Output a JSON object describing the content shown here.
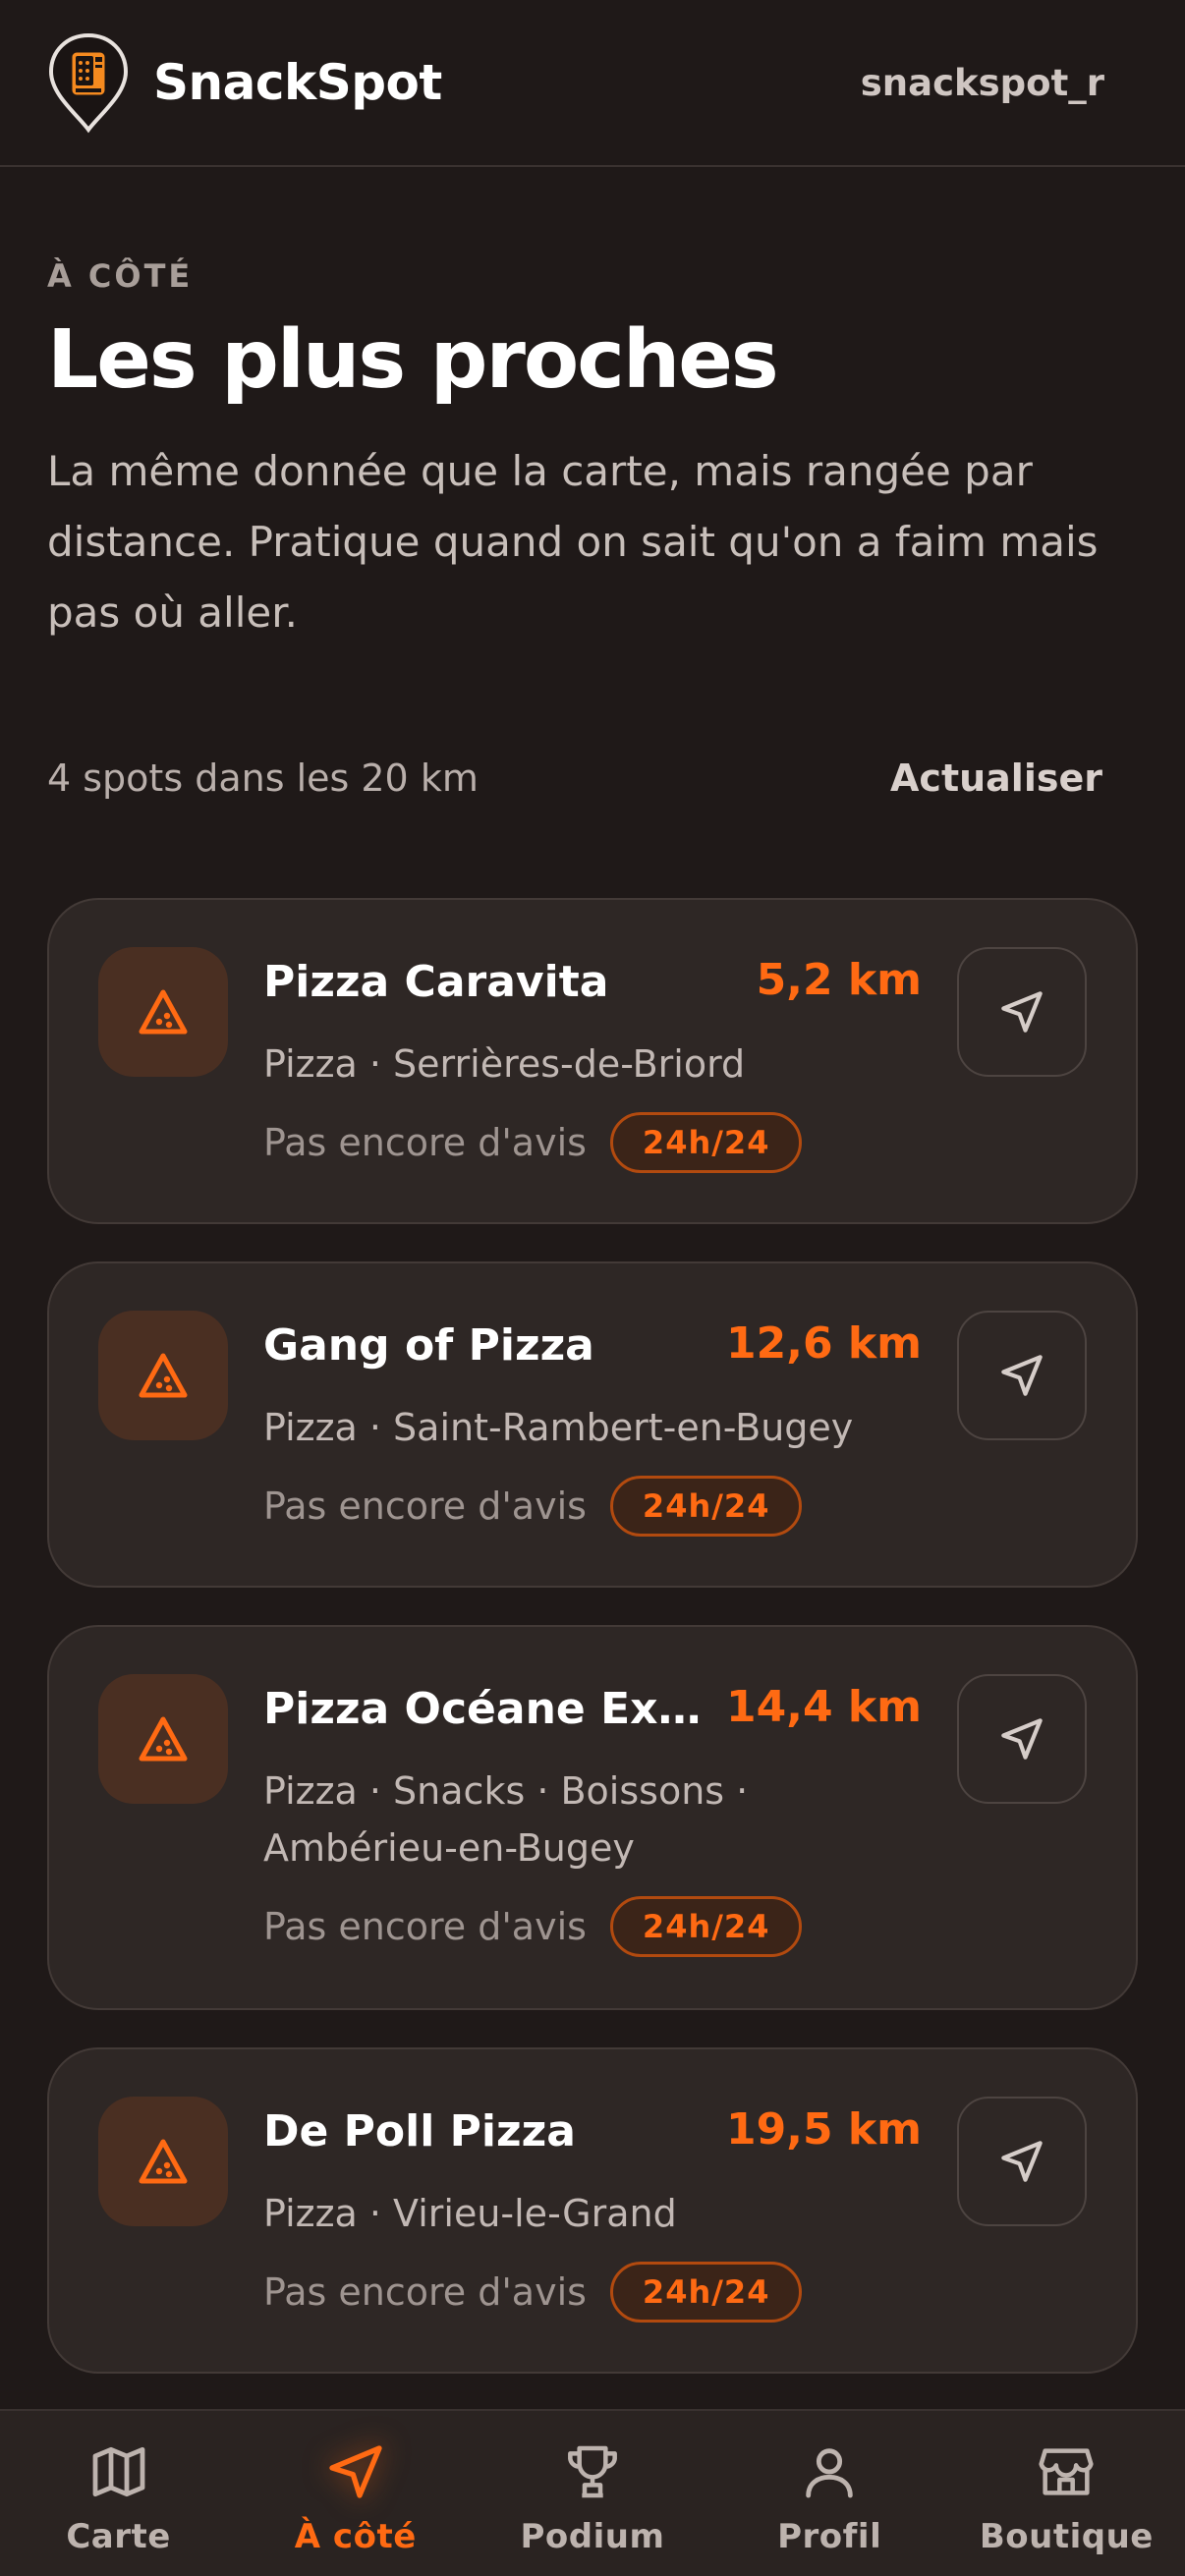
{
  "app": {
    "name": "SnackSpot",
    "username": "snackspot_r"
  },
  "hero": {
    "eyebrow": "À CÔTÉ",
    "title": "Les plus proches",
    "subtitle": "La même donnée que la carte, mais rangée par distance. Pratique quand on sait qu'on a faim mais pas où aller."
  },
  "toolbar": {
    "count": "4 spots dans les 20 km",
    "refresh_label": "Actualiser"
  },
  "spots": [
    {
      "name": "Pizza Caravita",
      "distance": "5,2 km",
      "meta": "Pizza · Serrières-de-Briord",
      "reviews": "Pas encore d'avis",
      "hours": "24h/24"
    },
    {
      "name": "Gang of Pizza",
      "distance": "12,6 km",
      "meta": "Pizza · Saint-Rambert-en-Bugey",
      "reviews": "Pas encore d'avis",
      "hours": "24h/24"
    },
    {
      "name": "Pizza Océane Expr...",
      "distance": "14,4 km",
      "meta": "Pizza · Snacks · Boissons · Ambérieu-en-Bugey",
      "reviews": "Pas encore d'avis",
      "hours": "24h/24"
    },
    {
      "name": "De Poll Pizza",
      "distance": "19,5 km",
      "meta": "Pizza · Virieu-le-Grand",
      "reviews": "Pas encore d'avis",
      "hours": "24h/24"
    }
  ],
  "bottom_nav": [
    {
      "label": "Carte",
      "icon": "map-icon",
      "active": false
    },
    {
      "label": "À côté",
      "icon": "navigation-arrow-icon",
      "active": true
    },
    {
      "label": "Podium",
      "icon": "trophy-icon",
      "active": false
    },
    {
      "label": "Profil",
      "icon": "user-icon",
      "active": false
    },
    {
      "label": "Boutique",
      "icon": "store-icon",
      "active": false
    }
  ],
  "colors": {
    "accent": "#ff6a13",
    "background": "#1f1918",
    "card": "#2e2725"
  }
}
